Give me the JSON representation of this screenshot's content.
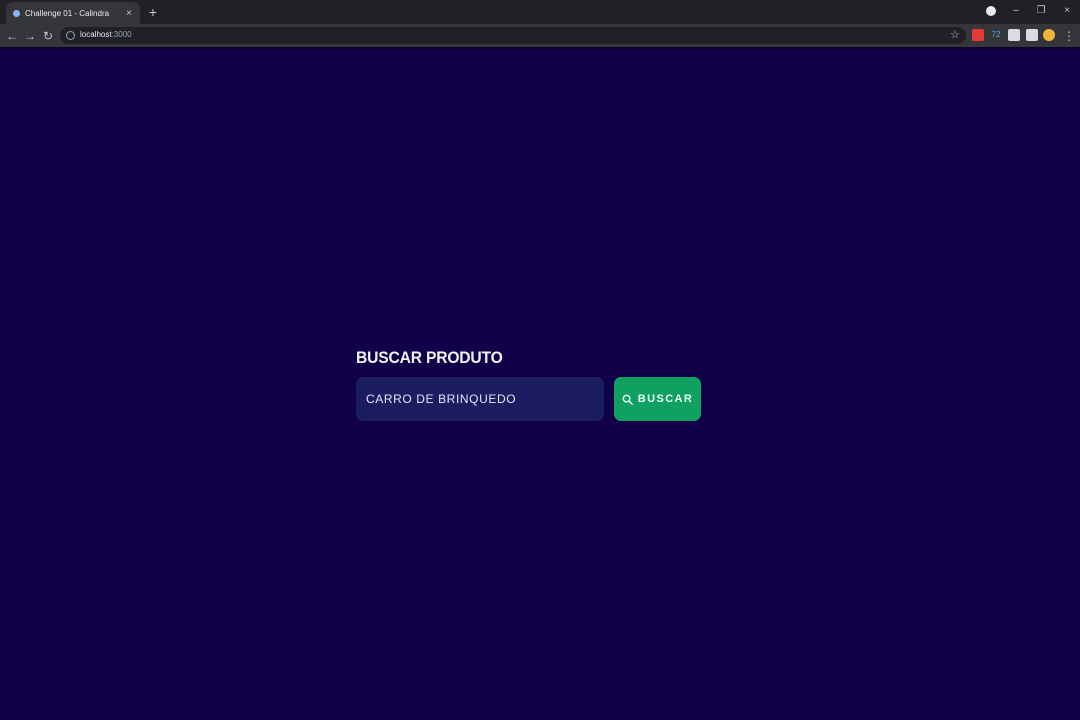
{
  "browser": {
    "tab_title": "Challenge 01 - Calindra",
    "tab_close": "×",
    "new_tab": "+",
    "url_host": "localhost",
    "url_port": ":3000",
    "window_controls": {
      "minimize": "–",
      "restore": "❐",
      "close": "×"
    },
    "extensions": [
      {
        "name": "red-extension-icon",
        "color": "#e53935",
        "label": ""
      },
      {
        "name": "blue-counter-extension-icon",
        "color": "#4fa3ff",
        "label": "72"
      },
      {
        "name": "puzzle-extension-icon",
        "color": "#dadce0",
        "label": ""
      },
      {
        "name": "reader-extension-icon",
        "color": "#dadce0",
        "label": ""
      },
      {
        "name": "profile-avatar-icon",
        "color": "#f2b43b",
        "label": ""
      }
    ]
  },
  "page": {
    "title": "BUSCAR PRODUTO",
    "search": {
      "value": "CARRO DE BRINQUEDO",
      "placeholder": ""
    },
    "button_label": "BUSCAR"
  },
  "colors": {
    "background": "#10004a",
    "input_bg": "#1c1c63",
    "button_bg": "#10a062"
  }
}
